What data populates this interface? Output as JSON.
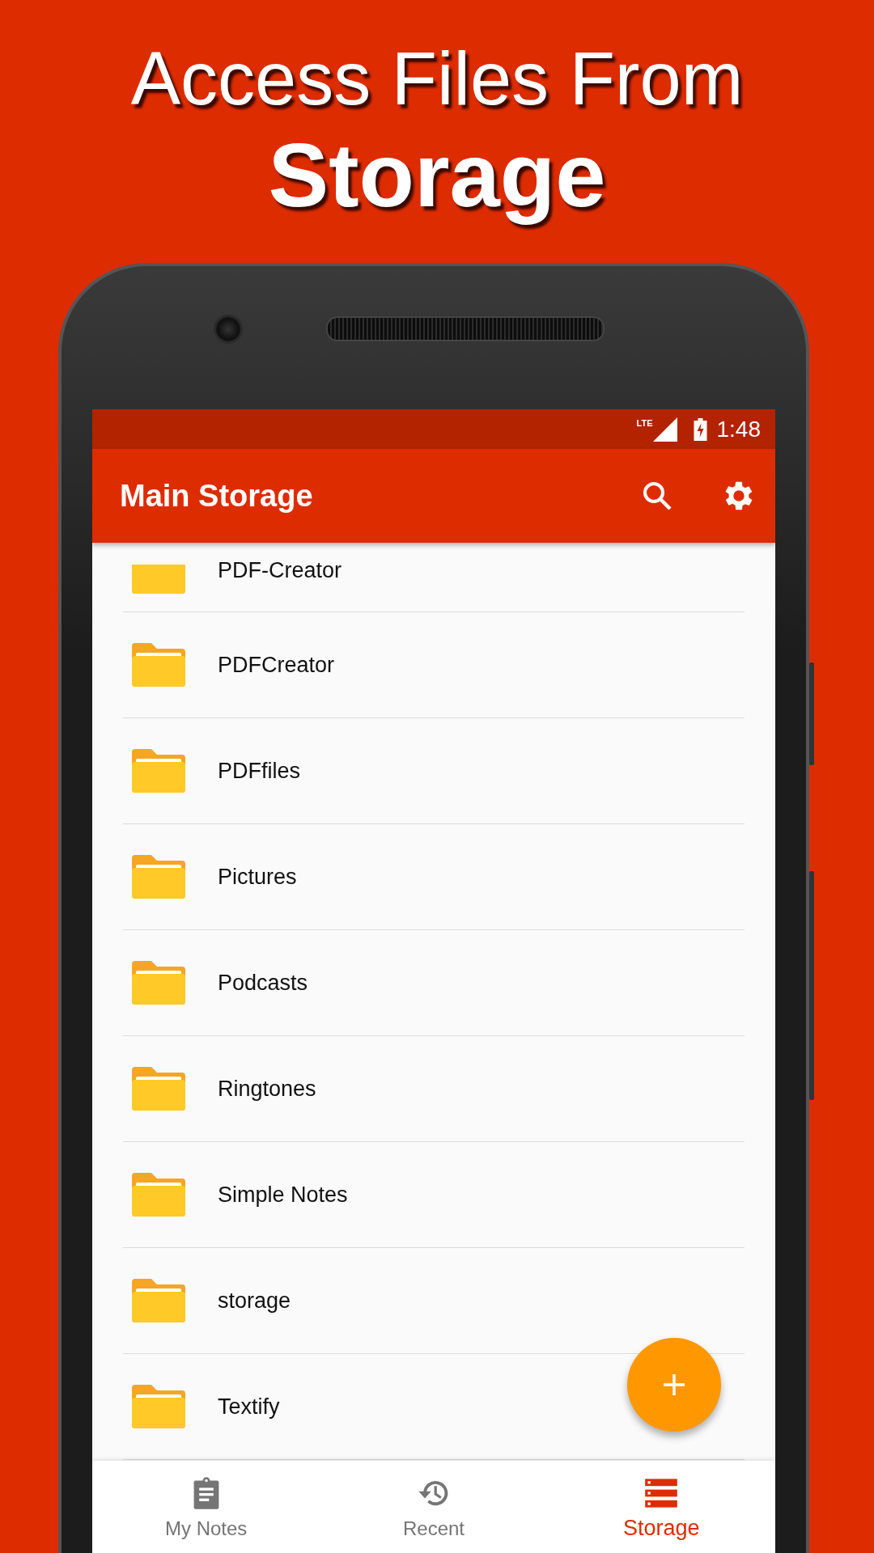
{
  "headline": {
    "line_1": "Access Files From",
    "line_2": "Storage"
  },
  "status_bar": {
    "network": "LTE",
    "time": "1:48"
  },
  "app_bar": {
    "title": "Main Storage"
  },
  "folders": [
    {
      "name": "PDF-Creator"
    },
    {
      "name": "PDFCreator"
    },
    {
      "name": "PDFfiles"
    },
    {
      "name": "Pictures"
    },
    {
      "name": "Podcasts"
    },
    {
      "name": "Ringtones"
    },
    {
      "name": "Simple Notes"
    },
    {
      "name": "storage"
    },
    {
      "name": "Textify"
    }
  ],
  "bottom_nav": [
    {
      "label": "My Notes",
      "kind": "notes",
      "selected": false
    },
    {
      "label": "Recent",
      "kind": "recent",
      "selected": false
    },
    {
      "label": "Storage",
      "kind": "storage",
      "selected": true
    }
  ]
}
